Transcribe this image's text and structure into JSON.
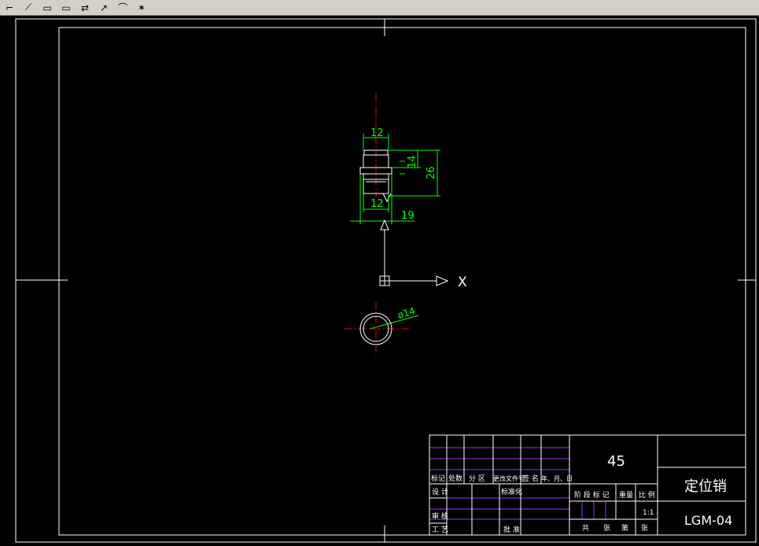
{
  "toolbar": {
    "tools": [
      {
        "name": "dimension-angular-tool",
        "glyph": "⌐"
      },
      {
        "name": "dimension-linear-tool",
        "glyph": "⟋"
      },
      {
        "name": "copy-tool",
        "glyph": "▭"
      },
      {
        "name": "paste-tool",
        "glyph": "▭"
      },
      {
        "name": "mirror-tool",
        "glyph": "⇄"
      },
      {
        "name": "leader-tool",
        "glyph": "↗"
      },
      {
        "name": "spline-tool",
        "glyph": "⌒"
      },
      {
        "name": "explode-tool",
        "glyph": "✶"
      }
    ]
  },
  "drawing": {
    "dim_top_width": "12",
    "dim_bottom_width": "12",
    "dim_overall_width": "19",
    "dim_height_small": "14",
    "dim_height_large": "26",
    "dim_diameter": "ø14",
    "axis_x_label": "X"
  },
  "title_block": {
    "material": "45",
    "part_name": "定位销",
    "drawing_number": "LGM-04",
    "scale": "1:1",
    "labels": {
      "mark": "标记",
      "count": "处数",
      "zone": "分 区",
      "change_doc": "更改文件号",
      "signature": "签 名",
      "date": "年、月、日",
      "design": "设 计",
      "standardize": "标准化",
      "stage_mark": "阶 段 标 记",
      "weight": "重量",
      "ratio": "比 例",
      "review": "审 核",
      "process": "工 艺",
      "approve": "批 准",
      "total": "共",
      "sheet": "张",
      "page": "第",
      "page_sheet": "张"
    }
  }
}
